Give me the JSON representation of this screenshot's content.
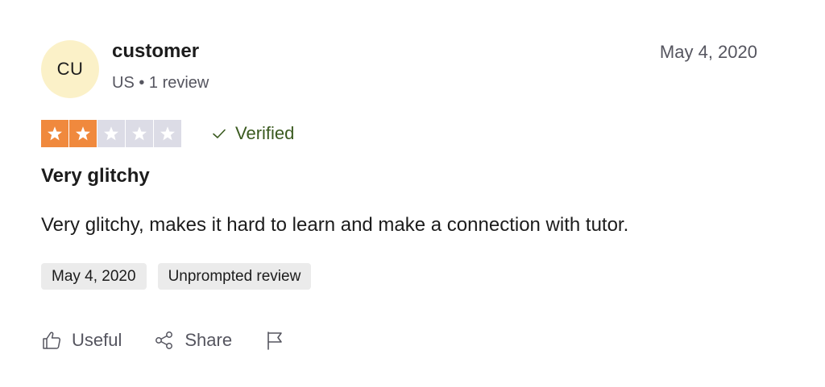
{
  "review": {
    "avatar_initials": "CU",
    "reviewer_name": "customer",
    "reviewer_meta": "US • 1 review",
    "date": "May 4, 2020",
    "rating": 2,
    "rating_max": 5,
    "verified_label": "Verified",
    "title": "Very glitchy",
    "body": "Very glitchy, makes it hard to learn and make a connection with tutor.",
    "tags": [
      "May 4, 2020",
      "Unprompted review"
    ],
    "actions": {
      "useful": "Useful",
      "share": "Share"
    }
  },
  "colors": {
    "star_filled": "#f0893d",
    "star_empty": "#dcdce6",
    "avatar_bg": "#fbf1c8",
    "verified": "#3a5a1f",
    "tag_bg": "#ebebeb"
  },
  "icons": [
    "star-icon",
    "checkmark-icon",
    "thumbs-up-icon",
    "share-icon",
    "flag-icon"
  ]
}
